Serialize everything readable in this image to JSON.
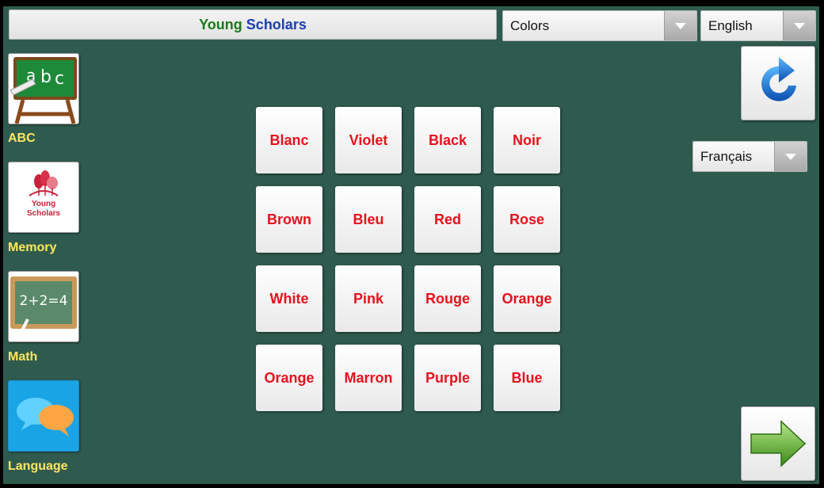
{
  "header": {
    "title_part1": "Young",
    "title_part2": "Scholars"
  },
  "category_select": {
    "value": "Colors"
  },
  "language_select": {
    "value": "English"
  },
  "target_language_select": {
    "value": "Français"
  },
  "sidebar": {
    "items": [
      {
        "label": "ABC",
        "icon": "abc-chalkboard-icon"
      },
      {
        "label": "Memory",
        "icon": "young-scholars-logo-icon",
        "logo_text_line1": "Young",
        "logo_text_line2": "Scholars"
      },
      {
        "label": "Math",
        "icon": "math-chalkboard-icon",
        "board_text": "2+2=4"
      },
      {
        "label": "Language",
        "icon": "speech-bubbles-icon"
      }
    ]
  },
  "grid": {
    "tiles": [
      "Blanc",
      "Violet",
      "Black",
      "Noir",
      "Brown",
      "Bleu",
      "Red",
      "Rose",
      "White",
      "Pink",
      "Rouge",
      "Orange",
      "Orange",
      "Marron",
      "Purple",
      "Blue"
    ]
  },
  "colors": {
    "background": "#2f5b4f",
    "tile_text": "#e8101c",
    "sidebar_label": "#ffe760",
    "title_green": "#1a7a1a",
    "title_blue": "#1a3fb0"
  }
}
